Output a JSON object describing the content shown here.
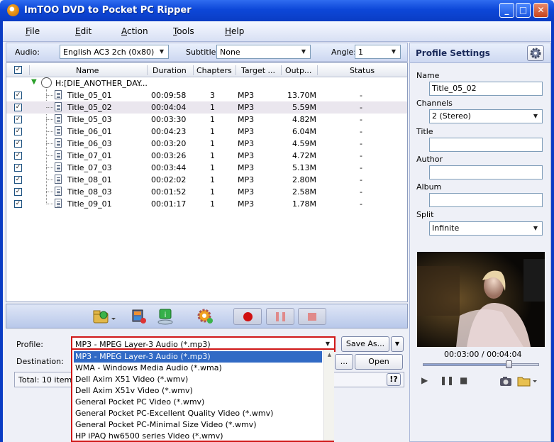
{
  "window": {
    "title": "ImTOO DVD to Pocket PC Ripper",
    "min": "_",
    "max": "□",
    "close": "✕"
  },
  "menu": [
    {
      "u": "F",
      "rest": "ile"
    },
    {
      "u": "E",
      "rest": "dit"
    },
    {
      "u": "A",
      "rest": "ction"
    },
    {
      "u": "T",
      "rest": "ools"
    },
    {
      "u": "H",
      "rest": "elp"
    }
  ],
  "options": {
    "audio_label": "Audio:",
    "audio_value": "English AC3 2ch (0x80)",
    "subtitle_label": "Subtitle:",
    "subtitle_value": "None",
    "angle_label": "Angle:",
    "angle_value": "1"
  },
  "list": {
    "columns": [
      "Name",
      "Duration",
      "Chapters",
      "Target ...",
      "Outp...",
      "Status"
    ],
    "root": "H:[DIE_ANOTHER_DAY...",
    "rows": [
      {
        "name": "Title_05_01",
        "duration": "00:09:58",
        "chapters": "3",
        "target": "MP3",
        "output": "13.70M",
        "status": "-"
      },
      {
        "name": "Title_05_02",
        "duration": "00:04:04",
        "chapters": "1",
        "target": "MP3",
        "output": "5.59M",
        "status": "-"
      },
      {
        "name": "Title_05_03",
        "duration": "00:03:30",
        "chapters": "1",
        "target": "MP3",
        "output": "4.82M",
        "status": "-"
      },
      {
        "name": "Title_06_01",
        "duration": "00:04:23",
        "chapters": "1",
        "target": "MP3",
        "output": "6.04M",
        "status": "-"
      },
      {
        "name": "Title_06_03",
        "duration": "00:03:20",
        "chapters": "1",
        "target": "MP3",
        "output": "4.59M",
        "status": "-"
      },
      {
        "name": "Title_07_01",
        "duration": "00:03:26",
        "chapters": "1",
        "target": "MP3",
        "output": "4.72M",
        "status": "-"
      },
      {
        "name": "Title_07_03",
        "duration": "00:03:44",
        "chapters": "1",
        "target": "MP3",
        "output": "5.13M",
        "status": "-"
      },
      {
        "name": "Title_08_01",
        "duration": "00:02:02",
        "chapters": "1",
        "target": "MP3",
        "output": "2.80M",
        "status": "-"
      },
      {
        "name": "Title_08_03",
        "duration": "00:01:52",
        "chapters": "1",
        "target": "MP3",
        "output": "2.58M",
        "status": "-"
      },
      {
        "name": "Title_09_01",
        "duration": "00:01:17",
        "chapters": "1",
        "target": "MP3",
        "output": "1.78M",
        "status": "-"
      }
    ]
  },
  "bottom": {
    "profile_label": "Profile:",
    "profile_value": "MP3 - MPEG Layer-3 Audio  (*.mp3)",
    "save_as": "Save As...",
    "destination_label": "Destination:",
    "browse": "...",
    "open": "Open",
    "total": "Total: 10 items,",
    "help": "!?"
  },
  "dropdown": [
    "MP3 - MPEG Layer-3 Audio  (*.mp3)",
    "WMA - Windows Media Audio  (*.wma)",
    "Dell Axim X51 Video  (*.wmv)",
    "Dell Axim X51v Video  (*.wmv)",
    "General Pocket PC Video  (*.wmv)",
    "General Pocket PC-Excellent Quality Video  (*.wmv)",
    "General Pocket PC-Minimal Size Video  (*.wmv)",
    "HP iPAQ hw6500 series Video  (*.wmv)"
  ],
  "profile_settings": {
    "title": "Profile Settings",
    "name_label": "Name",
    "name_value": "Title_05_02",
    "channels_label": "Channels",
    "channels_value": "2 (Stereo)",
    "title_label": "Title",
    "author_label": "Author",
    "album_label": "Album",
    "split_label": "Split",
    "split_value": "Infinite"
  },
  "player": {
    "time": "00:03:00 / 00:04:04",
    "position": 0.74
  }
}
